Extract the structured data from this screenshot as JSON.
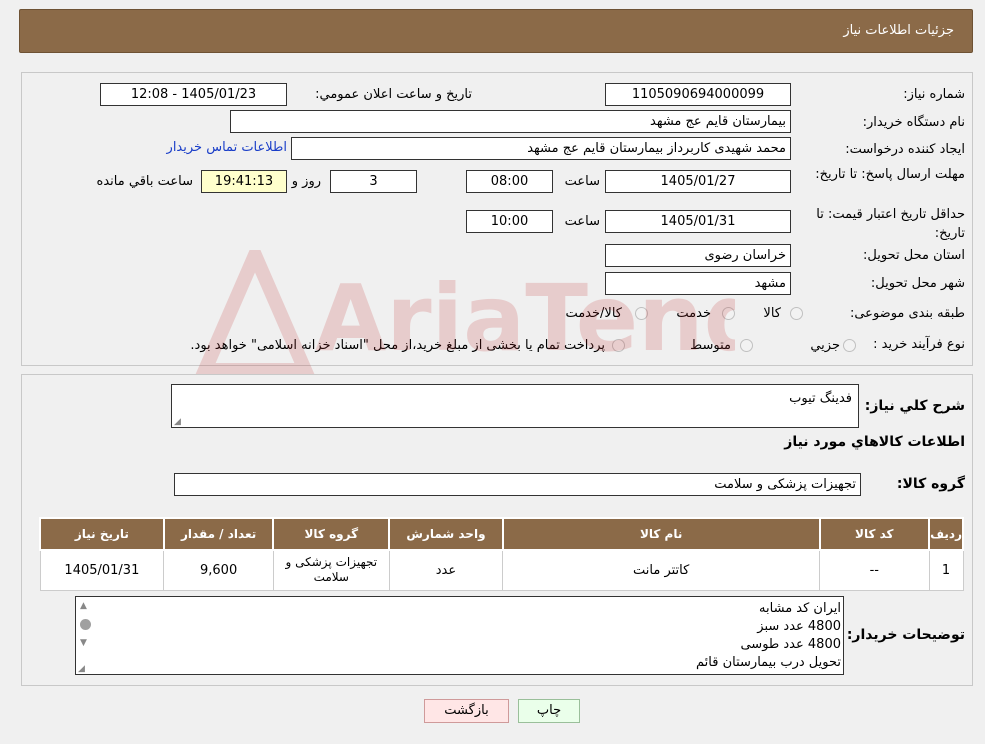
{
  "header": {
    "title": "جزئیات اطلاعات نیاز"
  },
  "form": {
    "need_number_label": "شماره نیاز:",
    "need_number": "1105090694000099",
    "announce_label": "تاریخ و ساعت اعلان عمومي:",
    "announce_value": "1405/01/23 - 12:08",
    "buyer_org_label": "نام دستگاه خريدار:",
    "buyer_org": "بیمارستان قایم  عج  مشهد",
    "creator_label": "ایجاد کننده درخواست:",
    "creator": "محمد شهیدی کاربرداز بیمارستان قایم  عج  مشهد",
    "contact_link": "اطلاعات تماس خريدار",
    "deadline_label": "مهلت ارسال پاسخ: تا تاریخ:",
    "deadline_date": "1405/01/27",
    "time_label": "ساعت",
    "deadline_time": "08:00",
    "days_value": "3",
    "days_label": "روز و",
    "remaining_time": "19:41:13",
    "remaining_label": "ساعت باقي مانده",
    "validity_label": "حداقل تاریخ اعتبار قیمت: تا تاریخ:",
    "validity_date": "1405/01/31",
    "validity_time": "10:00",
    "province_label": "استان محل تحویل:",
    "province": "خراسان رضوی",
    "city_label": "شهر محل تحویل:",
    "city": "مشهد",
    "category_label": "طبقه بندی موضوعی:",
    "category_options": [
      "کالا",
      "خدمت",
      "کالا/خدمت"
    ],
    "process_label": "نوع فرآیند خرید :",
    "process_options": [
      "جزیي",
      "متوسط"
    ],
    "process_note": "پرداخت تمام یا بخشی از مبلغ خرید،از محل \"اسناد خزانه اسلامی\" خواهد بود."
  },
  "details": {
    "summary_label": "شرح کلي نياز:",
    "summary_value": "فدینگ  تیوب",
    "goods_title": "اطلاعات کالاهاي مورد نياز",
    "group_label": "گروه کالا:",
    "group_value": "تجهیزات پزشکی و سلامت"
  },
  "table": {
    "headers": [
      "رديف",
      "کد کالا",
      "نام کالا",
      "واحد شمارش",
      "گروه کالا",
      "تعداد / مقدار",
      "تاريخ نياز"
    ],
    "rows": [
      {
        "row": "1",
        "code": "--",
        "name": "کاتتر مانت",
        "unit": "عدد",
        "group": "تجهیزات پزشکی و سلامت",
        "qty": "9,600",
        "date": "1405/01/31"
      }
    ]
  },
  "buyer_notes": {
    "label": "توضيحات خريدار:",
    "lines": [
      "ایران کد مشابه",
      "4800 عدد  سبز",
      "4800 عدد طوسی",
      "تحویل  درب  بیمارستان قائم"
    ]
  },
  "buttons": {
    "print": "چاپ",
    "back": "بازگشت"
  },
  "colors": {
    "header_bg": "#8b6a48",
    "link": "#1a3ec8",
    "back_btn_bg": "#ffe6e6",
    "print_btn_bg": "#eaffea"
  }
}
